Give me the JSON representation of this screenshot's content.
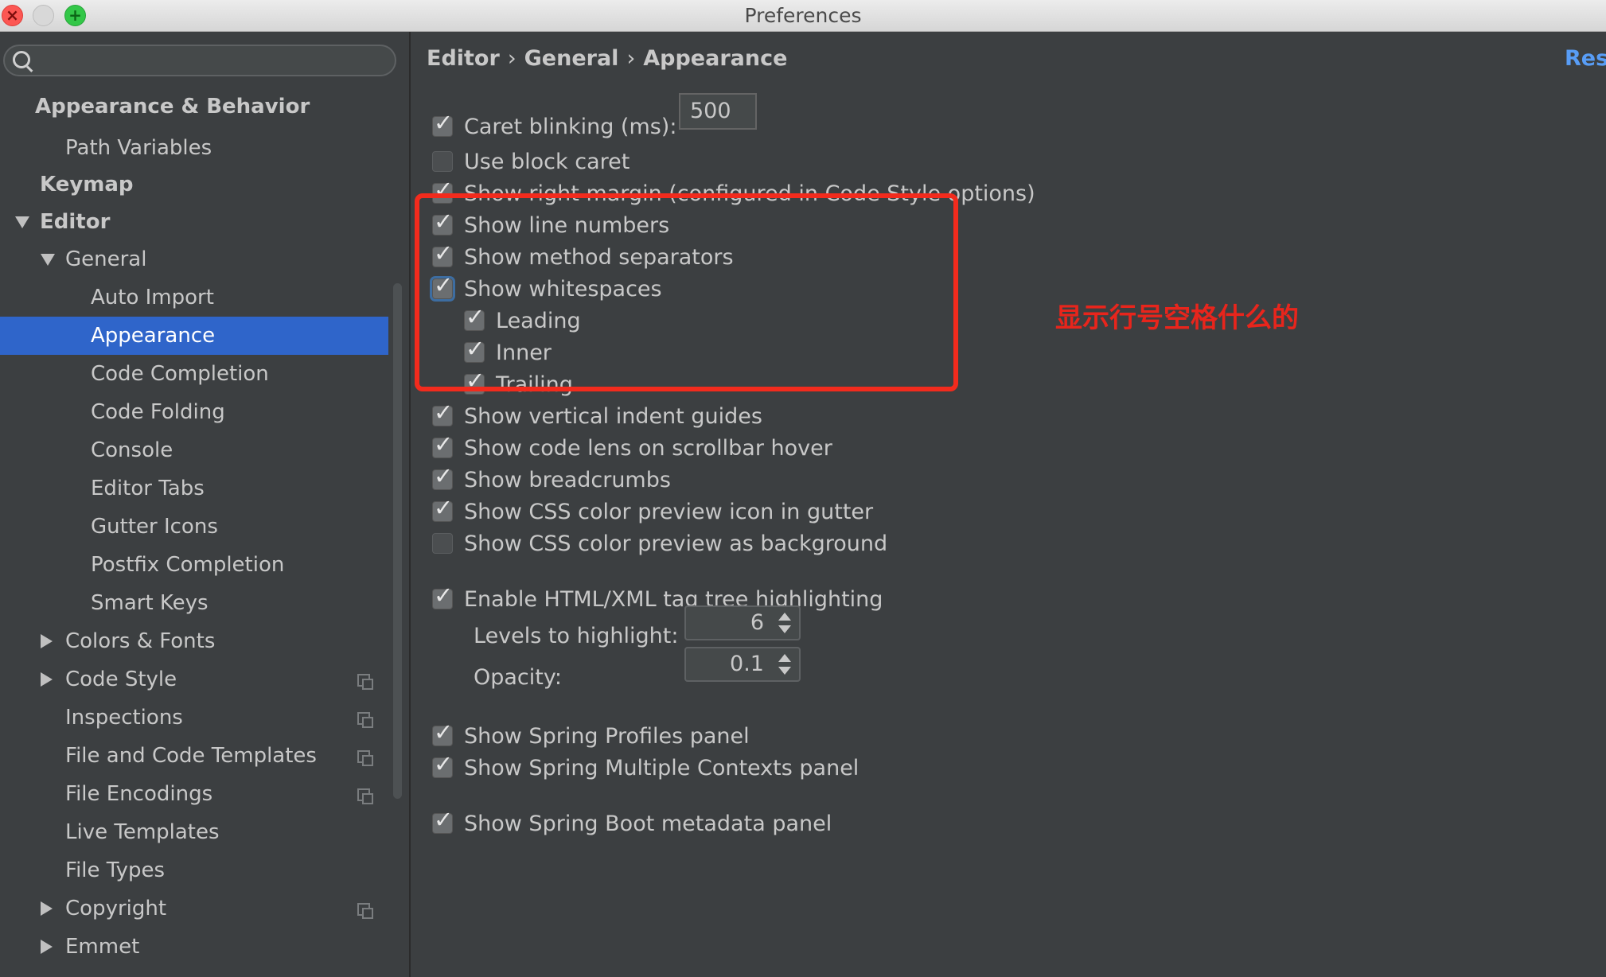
{
  "window": {
    "title": "Preferences",
    "close_glyph": "×",
    "maximize_glyph": "+"
  },
  "search": {
    "placeholder": "",
    "value": ""
  },
  "sidebar": {
    "items": [
      {
        "label": "Appearance & Behavior",
        "bold": true,
        "selected": false,
        "expander": "none",
        "copy_icon": false
      },
      {
        "label": "Path Variables",
        "bold": false,
        "selected": false,
        "expander": "none",
        "copy_icon": false
      },
      {
        "label": "Keymap",
        "bold": true,
        "selected": false,
        "expander": "none",
        "copy_icon": false
      },
      {
        "label": "Editor",
        "bold": true,
        "selected": false,
        "expander": "expanded",
        "copy_icon": false
      },
      {
        "label": "General",
        "bold": false,
        "selected": false,
        "expander": "expanded",
        "copy_icon": false
      },
      {
        "label": "Auto Import",
        "bold": false,
        "selected": false,
        "expander": "none",
        "copy_icon": false
      },
      {
        "label": "Appearance",
        "bold": false,
        "selected": true,
        "expander": "none",
        "copy_icon": false
      },
      {
        "label": "Code Completion",
        "bold": false,
        "selected": false,
        "expander": "none",
        "copy_icon": false
      },
      {
        "label": "Code Folding",
        "bold": false,
        "selected": false,
        "expander": "none",
        "copy_icon": false
      },
      {
        "label": "Console",
        "bold": false,
        "selected": false,
        "expander": "none",
        "copy_icon": false
      },
      {
        "label": "Editor Tabs",
        "bold": false,
        "selected": false,
        "expander": "none",
        "copy_icon": false
      },
      {
        "label": "Gutter Icons",
        "bold": false,
        "selected": false,
        "expander": "none",
        "copy_icon": false
      },
      {
        "label": "Postfix Completion",
        "bold": false,
        "selected": false,
        "expander": "none",
        "copy_icon": false
      },
      {
        "label": "Smart Keys",
        "bold": false,
        "selected": false,
        "expander": "none",
        "copy_icon": false
      },
      {
        "label": "Colors & Fonts",
        "bold": false,
        "selected": false,
        "expander": "collapsed",
        "copy_icon": false
      },
      {
        "label": "Code Style",
        "bold": false,
        "selected": false,
        "expander": "collapsed",
        "copy_icon": true
      },
      {
        "label": "Inspections",
        "bold": false,
        "selected": false,
        "expander": "none",
        "copy_icon": true
      },
      {
        "label": "File and Code Templates",
        "bold": false,
        "selected": false,
        "expander": "none",
        "copy_icon": true
      },
      {
        "label": "File Encodings",
        "bold": false,
        "selected": false,
        "expander": "none",
        "copy_icon": true
      },
      {
        "label": "Live Templates",
        "bold": false,
        "selected": false,
        "expander": "none",
        "copy_icon": false
      },
      {
        "label": "File Types",
        "bold": false,
        "selected": false,
        "expander": "none",
        "copy_icon": false
      },
      {
        "label": "Copyright",
        "bold": false,
        "selected": false,
        "expander": "collapsed",
        "copy_icon": true
      },
      {
        "label": "Emmet",
        "bold": false,
        "selected": false,
        "expander": "collapsed",
        "copy_icon": false
      }
    ]
  },
  "breadcrumb": {
    "parts": [
      "Editor",
      "General",
      "Appearance"
    ],
    "separator": "›"
  },
  "reset_label": "Res",
  "options": {
    "caret_blinking": {
      "label": "Caret blinking (ms):",
      "checked": true,
      "value": "500"
    },
    "block_caret": {
      "label": "Use block caret",
      "checked": false
    },
    "right_margin": {
      "label": "Show right margin (configured in Code Style options)",
      "checked": true
    },
    "line_numbers": {
      "label": "Show line numbers",
      "checked": true
    },
    "method_separators": {
      "label": "Show method separators",
      "checked": true
    },
    "whitespaces": {
      "label": "Show whitespaces",
      "checked": true
    },
    "leading": {
      "label": "Leading",
      "checked": true
    },
    "inner": {
      "label": "Inner",
      "checked": true
    },
    "trailing": {
      "label": "Trailing",
      "checked": true
    },
    "indent_guides": {
      "label": "Show vertical indent guides",
      "checked": true
    },
    "code_lens": {
      "label": "Show code lens on scrollbar hover",
      "checked": true
    },
    "breadcrumbs": {
      "label": "Show breadcrumbs",
      "checked": true
    },
    "css_icon": {
      "label": "Show CSS color preview icon in gutter",
      "checked": true
    },
    "css_bg": {
      "label": "Show CSS color preview as background",
      "checked": false
    },
    "tag_tree": {
      "label": "Enable HTML/XML tag tree highlighting",
      "checked": true
    },
    "spring_profiles": {
      "label": "Show Spring Profiles panel",
      "checked": true
    },
    "spring_contexts": {
      "label": "Show Spring Multiple Contexts panel",
      "checked": true
    },
    "spring_boot": {
      "label": "Show Spring Boot metadata panel",
      "checked": true
    }
  },
  "levels": {
    "label": "Levels to highlight:",
    "value": "6"
  },
  "opacity": {
    "label": "Opacity:",
    "value": "0.1"
  },
  "annotation": {
    "text": "显示行号空格什么的",
    "color": "#e8251c"
  },
  "colors": {
    "selection": "#2f65ca",
    "link": "#589df6",
    "background": "#3c3f41",
    "highlight_box": "#f22b1d"
  },
  "check_glyph": "✓"
}
